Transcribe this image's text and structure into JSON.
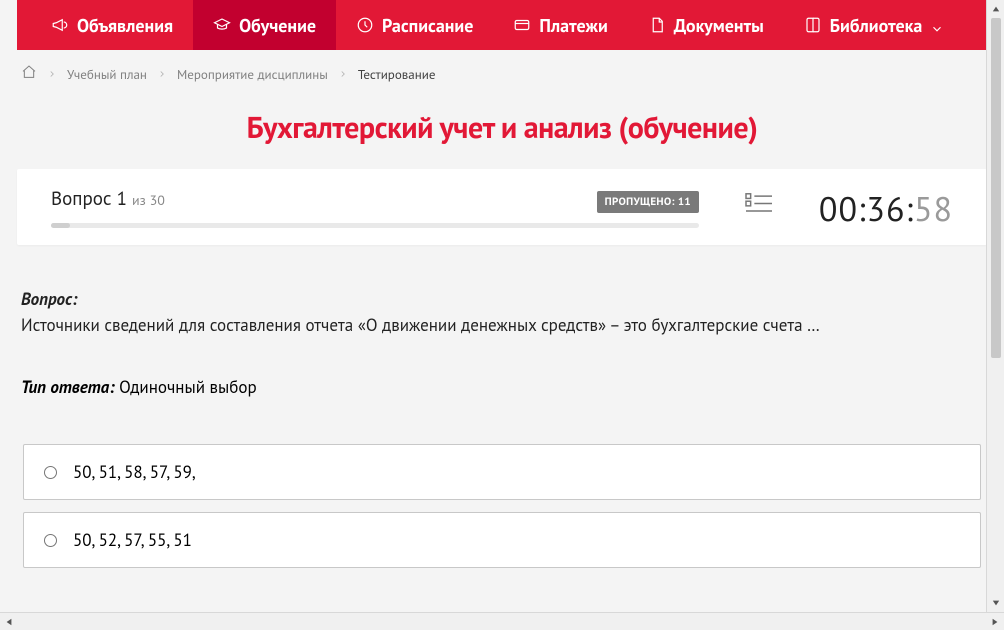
{
  "nav": {
    "items": [
      {
        "label": "Объявления",
        "icon": "megaphone-icon",
        "active": false
      },
      {
        "label": "Обучение",
        "icon": "graduation-cap-icon",
        "active": true
      },
      {
        "label": "Расписание",
        "icon": "clock-icon",
        "active": false
      },
      {
        "label": "Платежи",
        "icon": "card-icon",
        "active": false
      },
      {
        "label": "Документы",
        "icon": "document-icon",
        "active": false
      },
      {
        "label": "Библиотека",
        "icon": "book-icon",
        "active": false,
        "dropdown": true
      }
    ]
  },
  "breadcrumb": {
    "items": [
      "Учебный план",
      "Мероприятие дисциплины"
    ],
    "current": "Тестирование"
  },
  "page": {
    "title": "Бухгалтерский учет и анализ (обучение)"
  },
  "progress": {
    "question_word": "Вопрос",
    "current": "1",
    "of_word": "из",
    "total": "30",
    "skipped_label": "ПРОПУЩЕНО: 11",
    "timer_main": "00:36:",
    "timer_sec": "58"
  },
  "question": {
    "label": "Вопрос:",
    "text": "Источники сведений для составления отчета «О движении денежных средств» – это бухгалтерские счета …",
    "answer_type_label": "Тип ответа:",
    "answer_type_value": "Одиночный выбор"
  },
  "options": [
    {
      "text": "50, 51, 58, 57, 59,"
    },
    {
      "text": "50, 52, 57, 55, 51"
    }
  ]
}
